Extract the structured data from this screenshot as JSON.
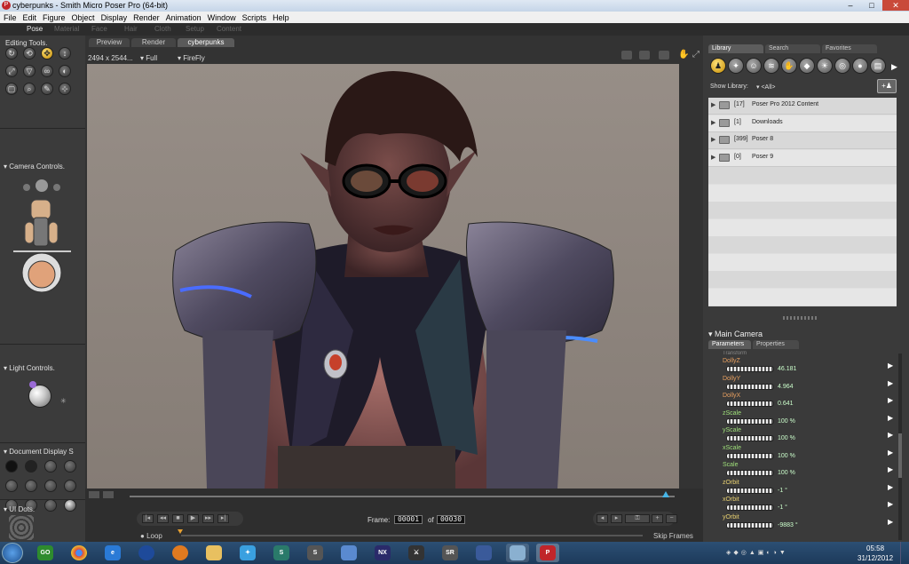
{
  "window": {
    "title": "cyberpunks - Smith Micro Poser Pro  (64-bit)",
    "minimize": "–",
    "maximize": "□",
    "close": "✕"
  },
  "menu": [
    "File",
    "Edit",
    "Figure",
    "Object",
    "Display",
    "Render",
    "Animation",
    "Window",
    "Scripts",
    "Help"
  ],
  "rooms": [
    "Pose",
    "Material",
    "Face",
    "Hair",
    "Cloth",
    "Setup",
    "Content"
  ],
  "left": {
    "editing_tools_title": "Editing Tools.",
    "camera_controls_title": "Camera Controls.",
    "light_controls_title": "Light Controls.",
    "document_display_title": "Document Display S",
    "ui_dots_label": "UI Dots."
  },
  "document": {
    "tabs": [
      "Preview",
      "Render",
      "cyberpunks"
    ],
    "resolution": "2494 x 2544...",
    "resolution_mode": "Full",
    "render_engine": "FireFly"
  },
  "timeline": {
    "frame_label": "Frame:",
    "frame_value": "00001",
    "of_label": "of",
    "total_frames": "00030",
    "loop_label": "Loop",
    "skip_frames_label": "Skip Frames"
  },
  "library": {
    "tabs": [
      "Library",
      "Search",
      "Favorites"
    ],
    "show_library_label": "Show Library:",
    "show_library_value": "<All>",
    "rows": [
      {
        "count": "[17]",
        "name": "Poser Pro 2012 Content"
      },
      {
        "count": "[1]",
        "name": "Downloads"
      },
      {
        "count": "[399]",
        "name": "Poser 8"
      },
      {
        "count": "[0]",
        "name": "Poser 9"
      }
    ]
  },
  "params": {
    "panel_title": "Main Camera",
    "tabs": [
      "Parameters",
      "Properties"
    ],
    "group_label": "Transform",
    "rows": [
      {
        "label": "DollyZ",
        "value": "46.181",
        "color": "#e8a060"
      },
      {
        "label": "DollyY",
        "value": "4.964",
        "color": "#e8a060"
      },
      {
        "label": "DollyX",
        "value": "0.641",
        "color": "#e8a060"
      },
      {
        "label": "zScale",
        "value": "100 %",
        "color": "#9fe07a"
      },
      {
        "label": "yScale",
        "value": "100 %",
        "color": "#9fe07a"
      },
      {
        "label": "xScale",
        "value": "100 %",
        "color": "#9fe07a"
      },
      {
        "label": "Scale",
        "value": "100 %",
        "color": "#9fe07a"
      },
      {
        "label": "zOrbit",
        "value": "-1 °",
        "color": "#e8d070"
      },
      {
        "label": "xOrbit",
        "value": "-1 °",
        "color": "#e8d070"
      },
      {
        "label": "yOrbit",
        "value": "-9883 °",
        "color": "#e8d070"
      }
    ]
  },
  "taskbar": {
    "clock_time": "05:58",
    "clock_date": "31/12/2012"
  }
}
